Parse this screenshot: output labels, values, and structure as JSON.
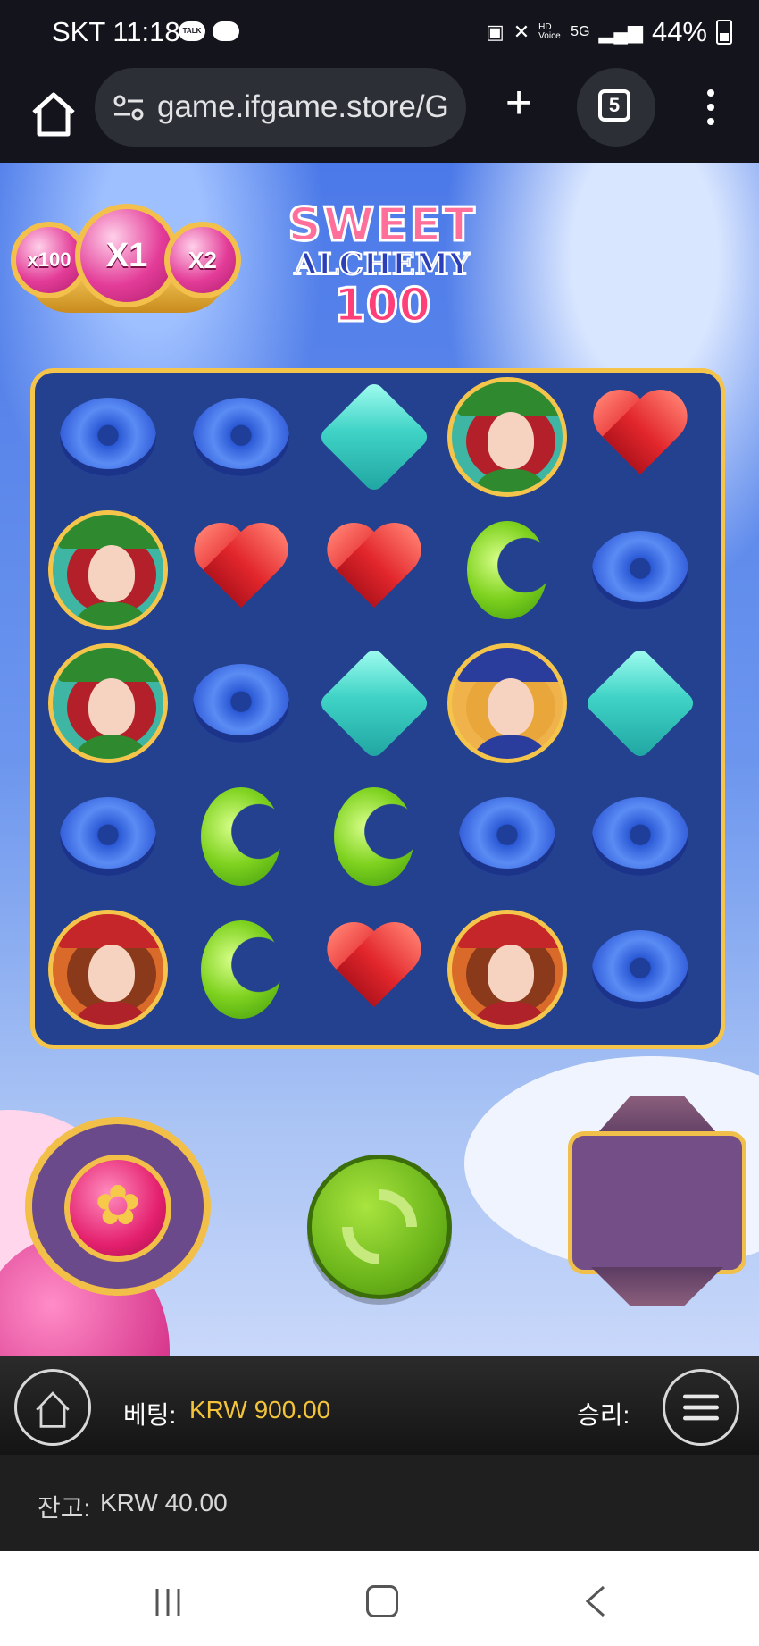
{
  "status_bar": {
    "carrier": "SKT",
    "time": "11:18",
    "chat_badge": "TALK",
    "net_label": "HD Voice",
    "net_5g": "5G",
    "battery": "44%"
  },
  "browser": {
    "url": "game.ifgame.store/G",
    "tab_count": "5"
  },
  "game": {
    "logo": {
      "line1": "SWEET",
      "line2": "ALCHEMY",
      "line3": "100"
    },
    "multipliers": [
      "x100",
      "X1",
      "X2"
    ],
    "grid": [
      [
        "blue",
        "teal-blue",
        "teal",
        "portrait-redhair",
        "heart"
      ],
      [
        "portrait-redhair",
        "heart",
        "heart",
        "green",
        "blue"
      ],
      [
        "portrait-redhair",
        "blue",
        "teal",
        "portrait-blonde",
        "teal"
      ],
      [
        "blue",
        "green",
        "green",
        "blue",
        "blue"
      ],
      [
        "portrait-brunette",
        "green",
        "heart",
        "portrait-brunette",
        "blue"
      ]
    ],
    "icons": {
      "spin": "refresh-icon",
      "bonus": "flower-icon"
    }
  },
  "footer": {
    "bet_label": "베팅:",
    "bet_value": "KRW 900.00",
    "win_label": "승리:",
    "balance_label": "잔고:",
    "balance_value": "KRW 40.00"
  },
  "colors": {
    "accent_gold": "#f4c54a",
    "bet_value": "#f3c43a",
    "spin_green": "#6cb61b"
  }
}
